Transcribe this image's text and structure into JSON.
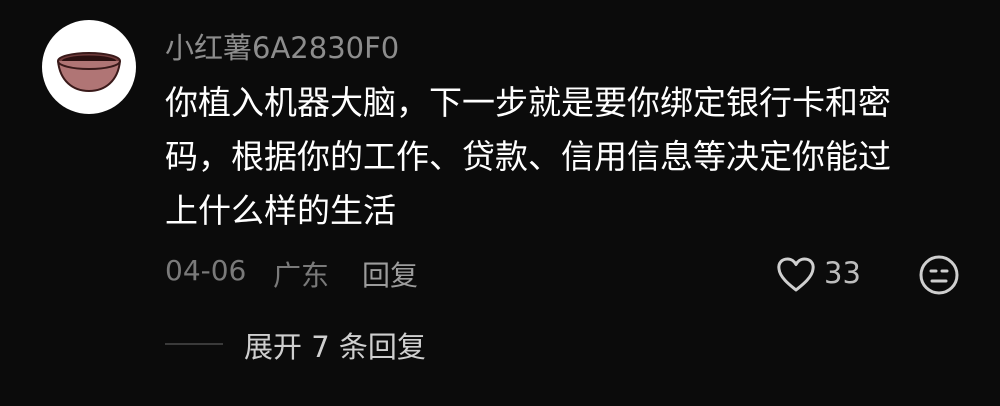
{
  "comment": {
    "avatar_icon": "bowl-avatar-icon",
    "username": "小红薯6A2830F0",
    "text_lines": [
      "你植入机器大脑，下一步就是要你绑定银行卡和密",
      "码，根据你的工作、贷款、信用信息等决定你能过",
      "上什么样的生活"
    ],
    "date": "04-06",
    "location": "广东",
    "reply_label": "回复",
    "like_icon": "heart-outline-icon",
    "like_count": "33",
    "emoji_icon": "emoji-face-icon",
    "expand_replies_label": "展开 7 条回复"
  },
  "colors": {
    "background": "#0b0b0b",
    "text_primary": "#ffffff",
    "text_secondary": "#8d8d8d",
    "icon": "#cfcfcf"
  }
}
